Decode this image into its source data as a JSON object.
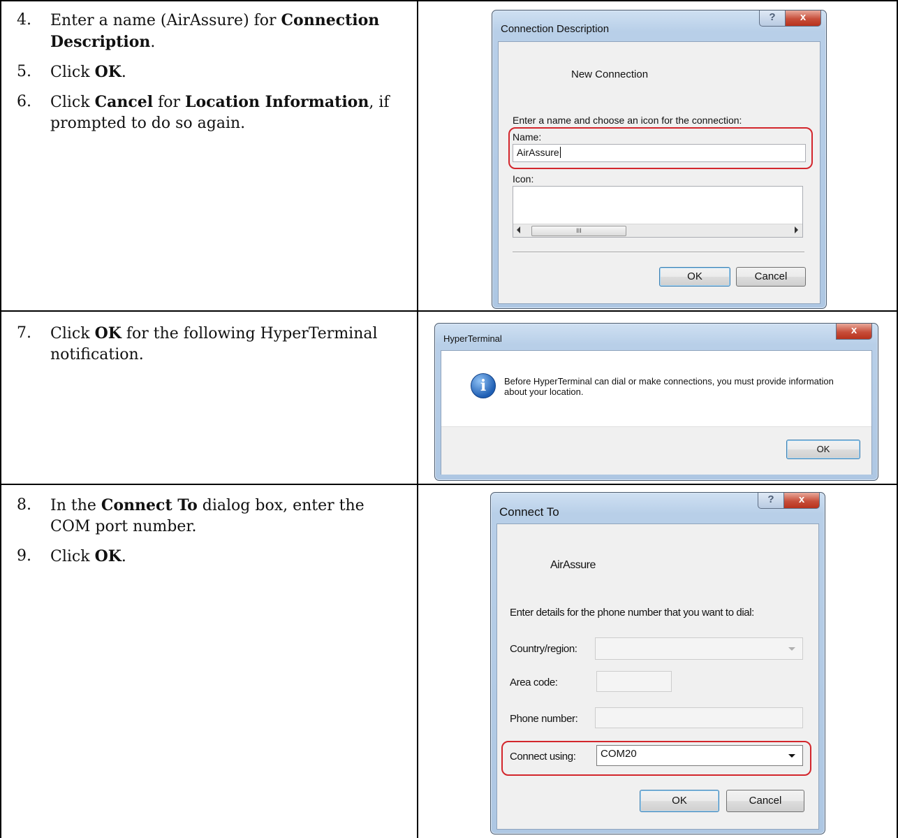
{
  "row1": {
    "steps": [
      {
        "num": "4.",
        "parts": [
          {
            "t": "Enter a name (AirAssure) for ",
            "b": false
          },
          {
            "t": "Connection Description",
            "b": true
          },
          {
            "t": ".",
            "b": false
          }
        ]
      },
      {
        "num": "5.",
        "parts": [
          {
            "t": "Click ",
            "b": false
          },
          {
            "t": "OK",
            "b": true
          },
          {
            "t": ".",
            "b": false
          }
        ]
      },
      {
        "num": "6.",
        "parts": [
          {
            "t": "Click ",
            "b": false
          },
          {
            "t": "Cancel",
            "b": true
          },
          {
            "t": " for ",
            "b": false
          },
          {
            "t": "Location Information",
            "b": true
          },
          {
            "t": ", if prompted to do so again.",
            "b": false
          }
        ]
      }
    ],
    "dialog": {
      "title": "Connection Description",
      "help_glyph": "?",
      "close_glyph": "x",
      "heading": "New Connection",
      "instruction": "Enter a name and choose an icon for the connection:",
      "name_label": "Name:",
      "name_value": "AirAssure",
      "icon_label": "Icon:",
      "scroll_glyph": "III",
      "ok": "OK",
      "cancel": "Cancel"
    }
  },
  "row2": {
    "steps": [
      {
        "num": "7.",
        "parts": [
          {
            "t": "Click ",
            "b": false
          },
          {
            "t": "OK",
            "b": true
          },
          {
            "t": " for the following HyperTerminal notification.",
            "b": false
          }
        ]
      }
    ],
    "dialog": {
      "title": "HyperTerminal",
      "close_glyph": "x",
      "info_glyph": "i",
      "message": "Before HyperTerminal can dial or make connections, you must provide information about your location.",
      "ok": "OK"
    }
  },
  "row3": {
    "steps": [
      {
        "num": "8.",
        "parts": [
          {
            "t": "In the ",
            "b": false
          },
          {
            "t": "Connect To",
            "b": true
          },
          {
            "t": " dialog box, enter the COM port number.",
            "b": false
          }
        ]
      },
      {
        "num": "9.",
        "parts": [
          {
            "t": "Click ",
            "b": false
          },
          {
            "t": "OK",
            "b": true
          },
          {
            "t": ".",
            "b": false
          }
        ]
      }
    ],
    "dialog": {
      "title": "Connect To",
      "help_glyph": "?",
      "close_glyph": "x",
      "heading": "AirAssure",
      "instruction": "Enter details for the phone number that you want to dial:",
      "country_label": "Country/region:",
      "area_label": "Area code:",
      "phone_label": "Phone number:",
      "connect_label": "Connect using:",
      "connect_value": "COM20",
      "ok": "OK",
      "cancel": "Cancel"
    }
  },
  "colors": {
    "highlight": "#d3262c",
    "close_button": "#c74e3a",
    "info_icon": "#1f5fb4"
  }
}
